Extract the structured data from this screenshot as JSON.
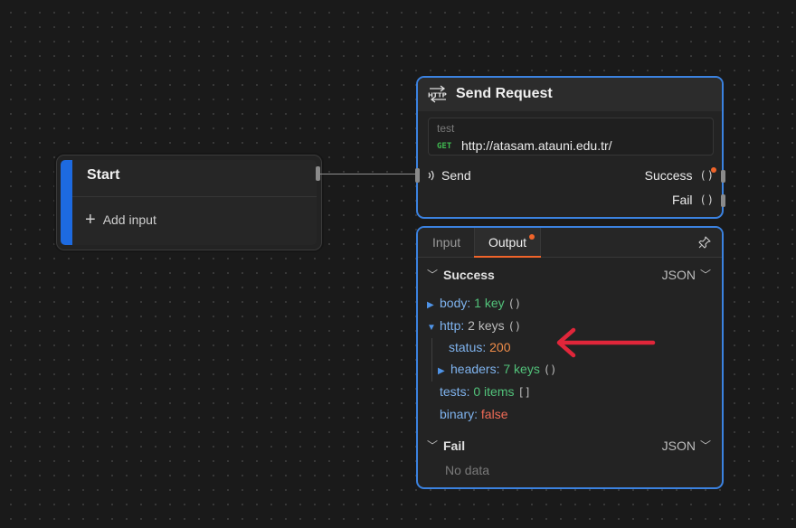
{
  "start_node": {
    "title": "Start",
    "add_input_label": "Add input"
  },
  "send_node": {
    "title": "Send Request",
    "icon": "http-icon",
    "request": {
      "name": "test",
      "method": "GET",
      "url": "http://atasam.atauni.edu.tr/"
    },
    "input_port": "Send",
    "outputs": [
      {
        "label": "Success",
        "value": "()"
      },
      {
        "label": "Fail",
        "value": "()"
      }
    ]
  },
  "output_panel": {
    "tabs": [
      "Input",
      "Output"
    ],
    "active_tab": "Output",
    "success": {
      "title": "Success",
      "format": "JSON",
      "items": {
        "body_key": "body:",
        "body_val": "1 key",
        "body_br": "()",
        "http_key": "http:",
        "http_val": "2 keys",
        "http_br": "()",
        "status_key": "status:",
        "status_val": "200",
        "headers_key": "headers:",
        "headers_val": "7 keys",
        "headers_br": "()",
        "tests_key": "tests:",
        "tests_val": "0 items",
        "tests_br": "[]",
        "binary_key": "binary:",
        "binary_val": "false"
      }
    },
    "fail": {
      "title": "Fail",
      "format": "JSON",
      "empty_text": "No data"
    }
  },
  "colors": {
    "accent": "#3b82e0",
    "start_bar": "#1d6ae0",
    "notify_dot": "#f0642a",
    "arrow": "#e0263a"
  }
}
